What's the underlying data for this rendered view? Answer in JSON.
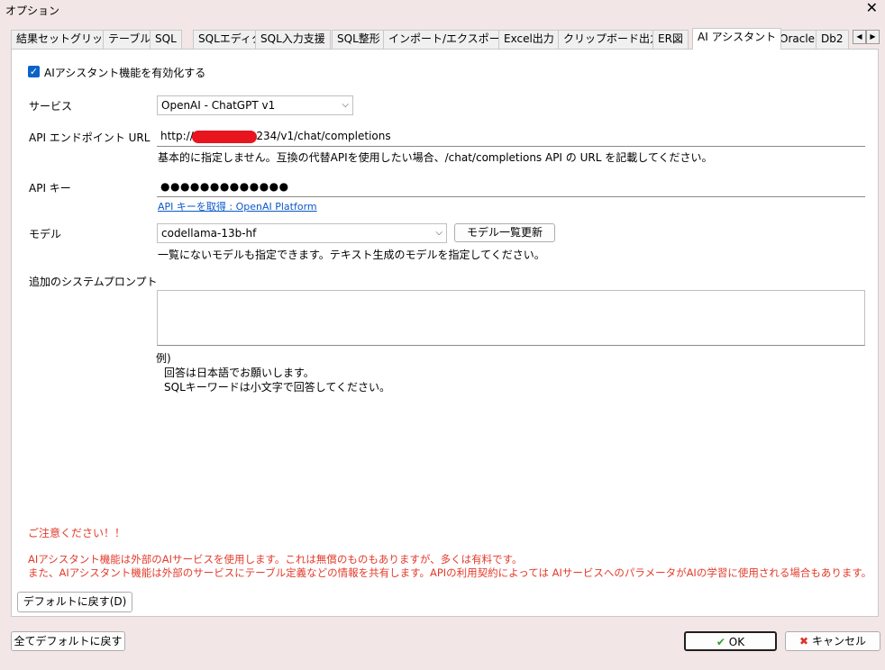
{
  "window": {
    "title": "オプション",
    "close_glyph": "✕"
  },
  "tabs": [
    "結果セットグリッド",
    "テーブル",
    "SQL",
    "SQLエディタ",
    "SQL入力支援",
    "SQL整形",
    "インポート/エクスポート",
    "Excel出力",
    "クリップボード出力",
    "ER図",
    "AI アシスタント",
    "Oracle",
    "Db2"
  ],
  "active_tab": "AI アシスタント",
  "tab_scroll": {
    "left": "◀",
    "right": "▶"
  },
  "enable_ai": {
    "label": "AIアシスタント機能を有効化する",
    "checked": true
  },
  "service": {
    "label": "サービス",
    "value": "OpenAI - ChatGPT v1"
  },
  "endpoint": {
    "label": "API エンドポイント URL",
    "value_prefix": "http://",
    "value_suffix": "1234/v1/chat/completions",
    "help": "基本的に指定しません。互換の代替APIを使用したい場合、/chat/completions API の URL を記載してください。"
  },
  "api_key": {
    "label": "API キー",
    "value": "●●●●●●●●●●●●●",
    "link": "API キーを取得 : OpenAI Platform"
  },
  "model": {
    "label": "モデル",
    "value": "codellama-13b-hf",
    "refresh_button": "モデル一覧更新",
    "help": "一覧にないモデルも指定できます。テキスト生成のモデルを指定してください。"
  },
  "system_prompt": {
    "label": "追加のシステムプロンプト",
    "value": "",
    "example_heading": "例)",
    "example_line1": "回答は日本語でお願いします。",
    "example_line2": "SQLキーワードは小文字で回答してください。"
  },
  "notice": {
    "heading": "ご注意ください！！",
    "line1": "AIアシスタント機能は外部のAIサービスを使用します。これは無償のものもありますが、多くは有料です。",
    "line2": "また、AIアシスタント機能は外部のサービスにテーブル定義などの情報を共有します。APIの利用契約によっては AIサービスへのパラメータがAIの学習に使用される場合もあります。"
  },
  "buttons": {
    "reset_tab": "デフォルトに戻す(D)",
    "reset_all": "全てデフォルトに戻す",
    "ok": "OK",
    "ok_glyph": "✔",
    "cancel": "キャンセル",
    "cancel_glyph": "✖"
  },
  "colors": {
    "accent": "#0a64c8",
    "warning": "#e33b2b",
    "link": "#0a58ca",
    "redaction": "#e8141e"
  }
}
